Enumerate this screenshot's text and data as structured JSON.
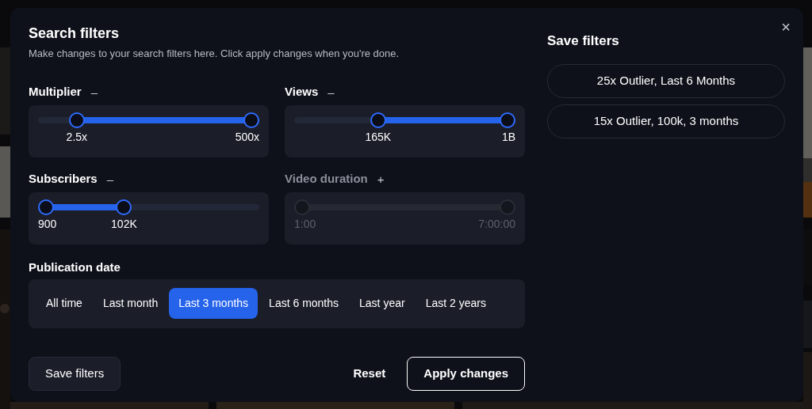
{
  "dialog": {
    "title": "Search filters",
    "description": "Make changes to your search filters here. Click apply changes when you're done.",
    "close": "×"
  },
  "sliders": [
    {
      "label": "Multiplier",
      "toggle": "–",
      "disabled": false,
      "thumbs": [
        {
          "level": 0.15,
          "reading": "2.5x"
        },
        {
          "level": 1,
          "reading": "500x"
        }
      ]
    },
    {
      "label": "Views",
      "toggle": "–",
      "disabled": false,
      "thumbs": [
        {
          "level": 0.37,
          "reading": "165K"
        },
        {
          "level": 1,
          "reading": "1B"
        }
      ]
    },
    {
      "label": "Subscribers",
      "toggle": "–",
      "disabled": false,
      "thumbs": [
        {
          "level": 0,
          "reading": "900"
        },
        {
          "level": 0.38,
          "reading": "102K"
        }
      ]
    },
    {
      "label": "Video duration",
      "toggle": "+",
      "disabled": true,
      "thumbs": [
        {
          "level": 0,
          "reading": "1:00"
        },
        {
          "level": 1,
          "reading": "7:00:00"
        }
      ]
    }
  ],
  "publication_date": {
    "label": "Publication date",
    "options": [
      {
        "label": "All time",
        "selected": false
      },
      {
        "label": "Last month",
        "selected": false
      },
      {
        "label": "Last 3 months",
        "selected": true
      },
      {
        "label": "Last 6 months",
        "selected": false
      },
      {
        "label": "Last year",
        "selected": false
      },
      {
        "label": "Last 2 years",
        "selected": false
      }
    ]
  },
  "footer": {
    "save": "Save filters",
    "reset": "Reset",
    "apply": "Apply changes"
  },
  "saved_filters": {
    "title": "Save filters",
    "items": [
      "25x Outlier, Last 6 Months",
      "15x Outlier, 100k, 3 months"
    ]
  }
}
